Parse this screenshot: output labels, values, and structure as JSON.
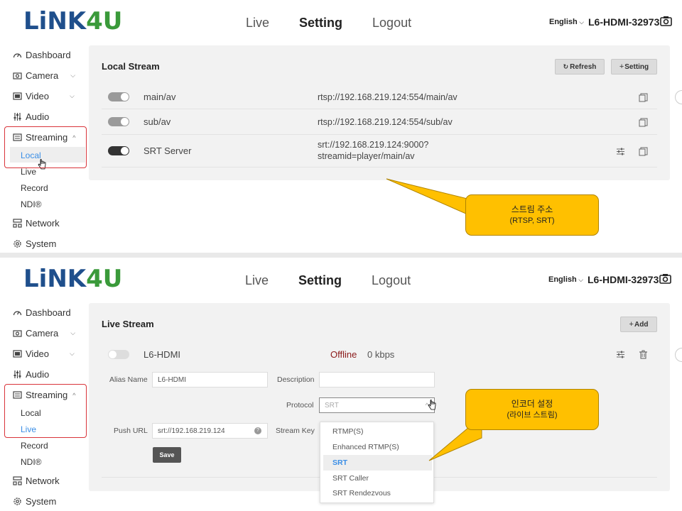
{
  "brand": {
    "logo_part1": "LiNK",
    "logo_part2": "4U"
  },
  "topnav": {
    "live": "Live",
    "setting": "Setting",
    "logout": "Logout"
  },
  "header": {
    "language": "English",
    "device_name": "L6-HDMI-32973"
  },
  "sidebar": {
    "dashboard": "Dashboard",
    "camera": "Camera",
    "video": "Video",
    "audio": "Audio",
    "streaming": "Streaming",
    "local": "Local",
    "live": "Live",
    "record": "Record",
    "ndi": "NDI®",
    "network": "Network",
    "system": "System"
  },
  "local_stream": {
    "title": "Local Stream",
    "refresh_label": "Refresh",
    "setting_label": "Setting",
    "rows": [
      {
        "name": "main/av",
        "url": "rtsp://192.168.219.124:554/main/av",
        "url2": ""
      },
      {
        "name": "sub/av",
        "url": "rtsp://192.168.219.124:554/sub/av",
        "url2": ""
      },
      {
        "name": "SRT Server",
        "url": "srt://192.168.219.124:9000?",
        "url2": "streamid=player/main/av"
      }
    ]
  },
  "callout_top": {
    "line1": "스트림 주소",
    "line2": "(RTSP, SRT)"
  },
  "live_stream": {
    "title": "Live Stream",
    "add_label": "Add",
    "entry": {
      "name": "L6-HDMI",
      "status": "Offline",
      "bitrate": "0 kbps"
    },
    "form": {
      "alias_label": "Alias Name",
      "alias_value": "L6-HDMI",
      "description_label": "Description",
      "description_value": "",
      "protocol_label": "Protocol",
      "protocol_value": "SRT",
      "push_url_label": "Push URL",
      "push_url_value": "srt://192.168.219.124",
      "stream_key_label": "Stream Key",
      "save_label": "Save"
    },
    "protocol_options": [
      "RTMP(S)",
      "Enhanced RTMP(S)",
      "SRT",
      "SRT Caller",
      "SRT Rendezvous"
    ]
  },
  "callout_bottom": {
    "line1": "인코더 설정",
    "line2": "(라이브 스트림)"
  },
  "colors": {
    "accent": "#3a8ee6",
    "callout": "#ffc000",
    "highlight_box": "#d9343a",
    "offline": "#8b1a1a"
  }
}
